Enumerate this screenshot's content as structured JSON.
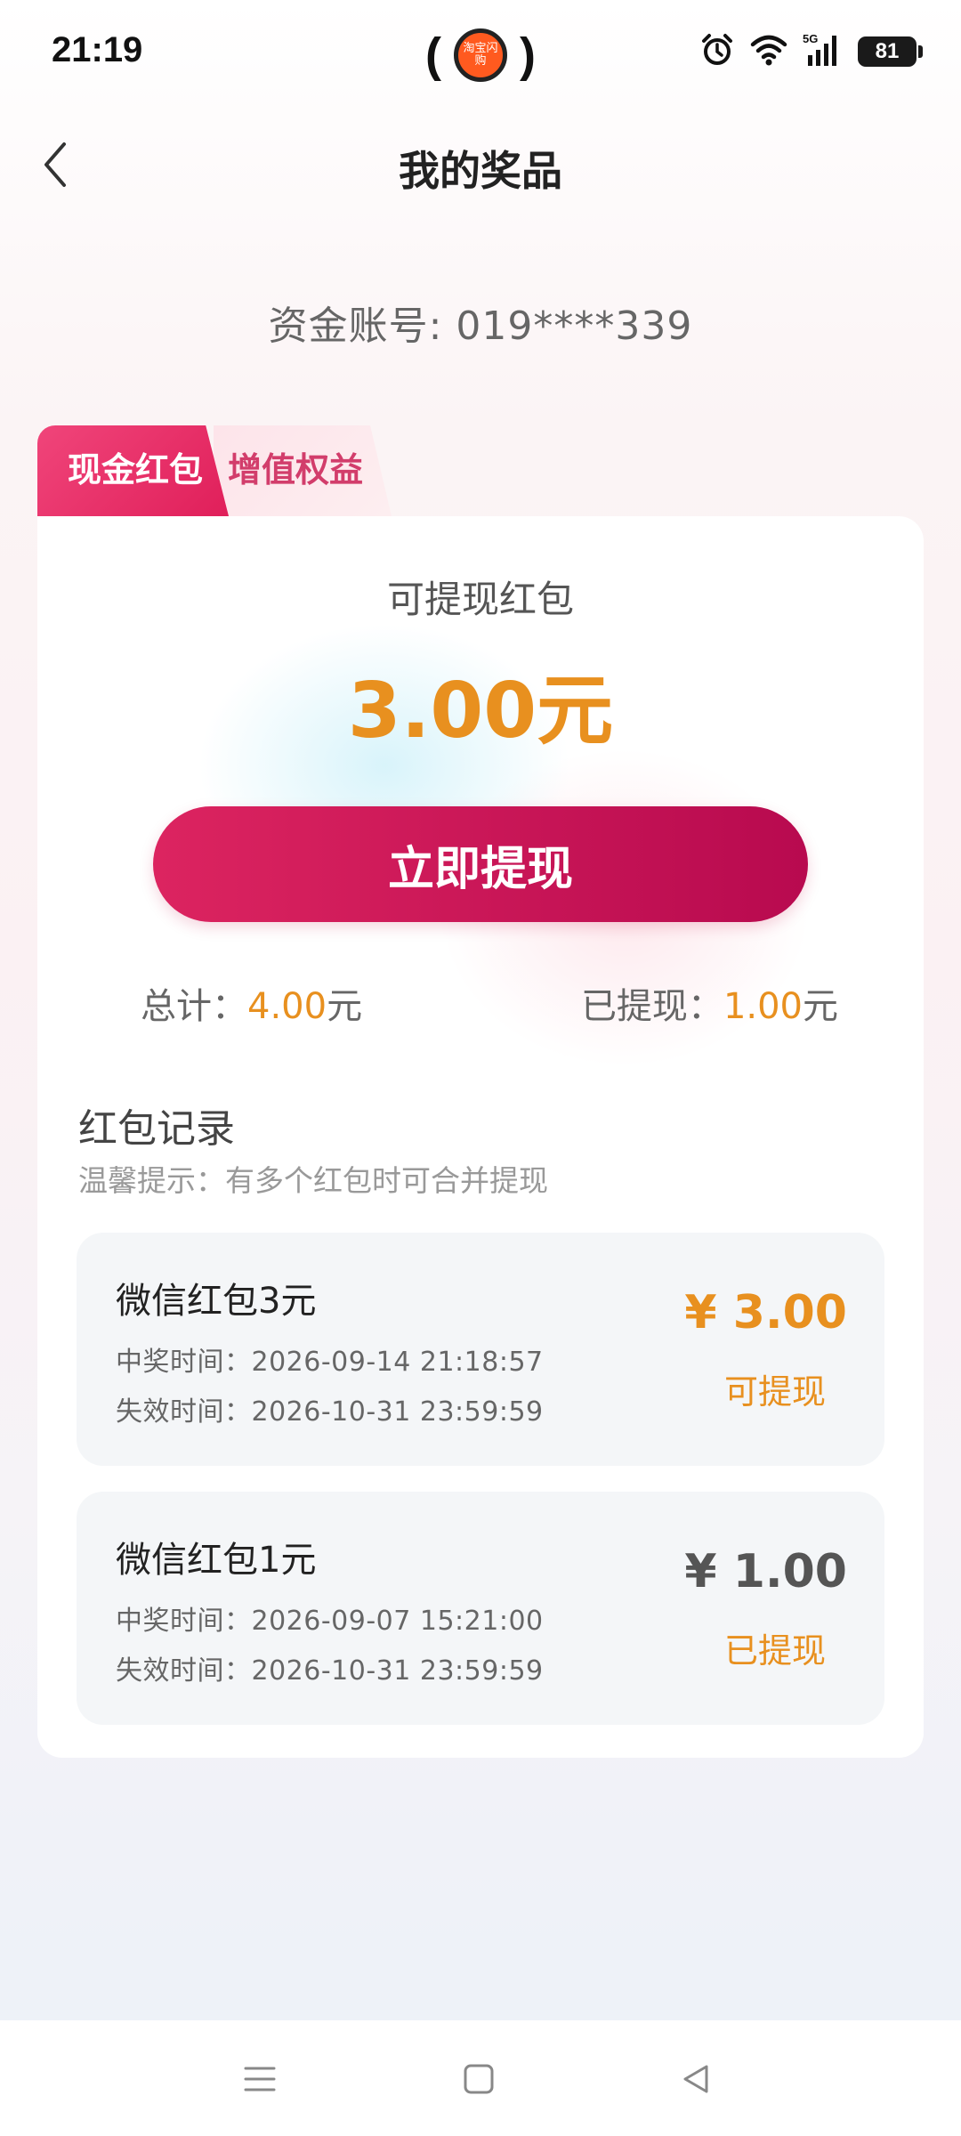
{
  "status_bar": {
    "time": "21:19",
    "app_badge": "淘宝闪购",
    "battery": "81",
    "network": "5G"
  },
  "header": {
    "title": "我的奖品"
  },
  "account": {
    "text": "资金账号: 019****339"
  },
  "tabs": [
    {
      "label": "现金红包",
      "active": true
    },
    {
      "label": "增值权益",
      "active": false
    }
  ],
  "summary": {
    "withdrawable_label": "可提现红包",
    "withdrawable_amount": "3.00元",
    "withdraw_button": "立即提现",
    "total_label": "总计：",
    "total_value": "4.00",
    "withdrawn_label": "已提现：",
    "withdrawn_value": "1.00",
    "unit": "元"
  },
  "records": {
    "title": "红包记录",
    "tip": "温馨提示：有多个红包时可合并提现",
    "items": [
      {
        "name": "微信红包3元",
        "win_time": "中奖时间：2026-09-14 21:18:57",
        "expire_time": "失效时间：2026-10-31 23:59:59",
        "amount": "¥ 3.00",
        "status": "可提现"
      },
      {
        "name": "微信红包1元",
        "win_time": "中奖时间：2026-09-07 15:21:00",
        "expire_time": "失效时间：2026-10-31 23:59:59",
        "amount": "¥ 1.00",
        "status": "已提现"
      }
    ]
  },
  "colors": {
    "accent_pink": "#dc2460",
    "amount_orange": "#e8901f"
  },
  "icons": {
    "back": "chevron-left-icon",
    "alarm": "alarm-icon",
    "wifi": "wifi-icon",
    "signal": "signal-icon",
    "nav_menu": "menu-icon",
    "nav_home": "square-icon",
    "nav_back": "triangle-back-icon"
  }
}
